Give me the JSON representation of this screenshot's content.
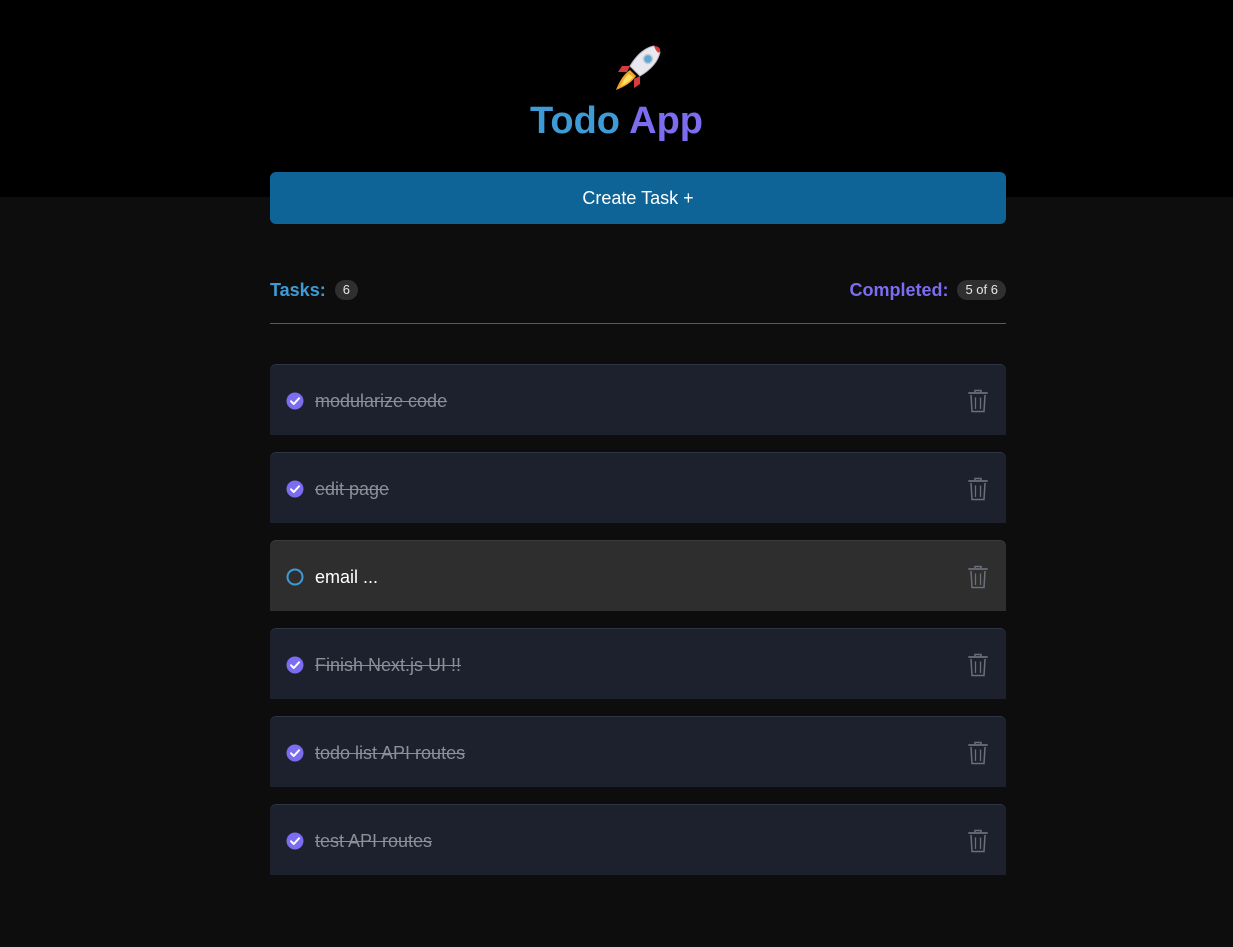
{
  "app": {
    "logo_icon": "rocket-icon",
    "title_part1": "Todo",
    "title_part2": "App"
  },
  "create_button_label": "Create Task +",
  "stats": {
    "tasks_label": "Tasks:",
    "tasks_count": "6",
    "completed_label": "Completed:",
    "completed_value": "5 of 6"
  },
  "tasks": [
    {
      "text": "modularize code",
      "completed": true
    },
    {
      "text": "edit page",
      "completed": true
    },
    {
      "text": "email ...",
      "completed": false
    },
    {
      "text": "Finish Next.js UI !!",
      "completed": true
    },
    {
      "text": "todo list API routes",
      "completed": true
    },
    {
      "text": "test API routes",
      "completed": true
    }
  ],
  "colors": {
    "accent_blue": "#3f9bd6",
    "accent_purple": "#7b6cf0",
    "button_bg": "#0e6496",
    "task_done_bg": "#1c212d",
    "task_pending_bg": "#2e2e2e"
  },
  "icons": {
    "completed": "check-circle-icon",
    "pending": "empty-circle-icon",
    "delete": "trash-icon"
  }
}
